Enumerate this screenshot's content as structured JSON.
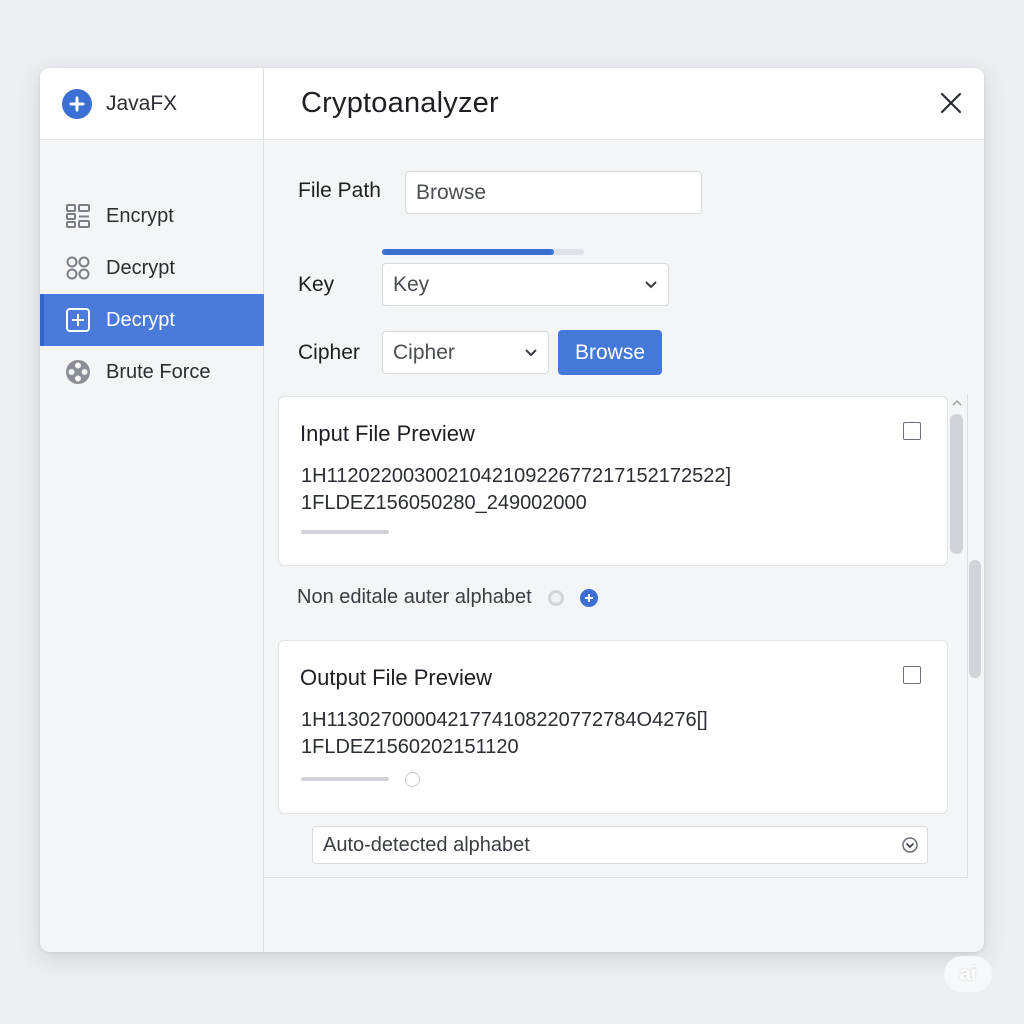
{
  "sidebar": {
    "brand": {
      "label": "JavaFX",
      "icon": "plus-circle-icon"
    },
    "items": [
      {
        "label": "Encrypt",
        "icon": "grid-icon",
        "active": false
      },
      {
        "label": "Decrypt",
        "icon": "circles-icon",
        "active": false
      },
      {
        "label": "Decrypt",
        "icon": "plus-square-icon",
        "active": true
      },
      {
        "label": "Brute Force",
        "icon": "reel-icon",
        "active": false
      }
    ]
  },
  "main": {
    "title": "Cryptoanalyzer",
    "file_path": {
      "label": "File Path",
      "value": "Browse"
    },
    "progress": 0.85,
    "key": {
      "label": "Key",
      "value": "Key"
    },
    "cipher": {
      "label": "Cipher",
      "value": "Cipher",
      "button": "Browse"
    },
    "input_preview": {
      "title": "Input File Preview",
      "line1": "1H112022003002104210922677217152172522]",
      "line2": "1FLDEZ156050280_249002000"
    },
    "alphabet_note": "Non editale auter alphabet",
    "output_preview": {
      "title": "Output File Preview",
      "line1": "1H1130270000421774108220772784O4276[]",
      "line2": "1FLDEZ1560202151120"
    },
    "alphabet_select": {
      "value": "Auto-detected alphabet"
    }
  },
  "colors": {
    "accent": "#3b6fd4",
    "active_nav": "#4a7bdc"
  },
  "watermark": "ai"
}
